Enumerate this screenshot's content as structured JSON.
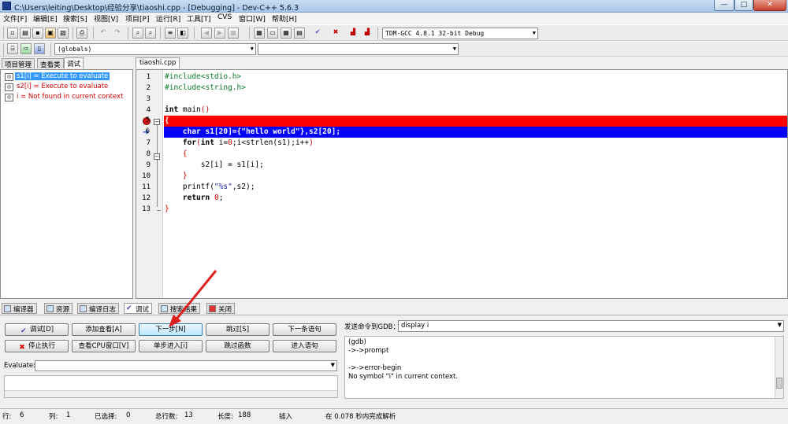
{
  "window": {
    "title": "C:\\Users\\leiting\\Desktop\\经验分享\\tiaoshi.cpp - [Debugging] - Dev-C++ 5.6.3",
    "min_label": "—",
    "max_label": "□",
    "close_label": "✕"
  },
  "menu": [
    "文件[F]",
    "编辑[E]",
    "搜索[S]",
    "视图[V]",
    "项目[P]",
    "运行[R]",
    "工具[T]",
    "CVS",
    "窗口[W]",
    "帮助[H]"
  ],
  "toolbar": {
    "compiler": "TDM-GCC 4.8.1 32-bit Debug",
    "scope": "(globals)"
  },
  "left_tabs": [
    "项目管理",
    "查看类",
    "调试"
  ],
  "watches": [
    {
      "text": "s1[i] = Execute to evaluate",
      "selected": true
    },
    {
      "text": "s2[i] = Execute to evaluate",
      "selected": false
    },
    {
      "text": "i = Not found in current context",
      "selected": false
    }
  ],
  "editor": {
    "tab": "tiaoshi.cpp",
    "line_numbers": [
      "1",
      "2",
      "3",
      "4",
      "5",
      "6",
      "7",
      "8",
      "9",
      "10",
      "11",
      "12",
      "13"
    ],
    "breakpoint_line": 5,
    "current_line": 6,
    "colors": {
      "breakpoint": "#ff0000",
      "current": "#0000ff"
    }
  },
  "code": {
    "l1": "#include<stdio.h>",
    "l2": "#include<string.h>",
    "l4a": "int",
    "l4b": " main",
    "l4c": "()",
    "l5": "{",
    "l6": "    char s1[20]={\"hello world\"},s2[20];",
    "l7a": "    ",
    "l7b": "for",
    "l7c": "(",
    "l7d": "int",
    "l7e": " i=",
    "l7f": "0",
    "l7g": ";i<strlen(s1);i++",
    "l7h": ")",
    "l8": "    {",
    "l9a": "        s2[i] = s1[i];",
    "l10": "    }",
    "l11a": "    printf(",
    "l11b": "\"%s\"",
    "l11c": ",s2);",
    "l12a": "    ",
    "l12b": "return",
    "l12c": " ",
    "l12d": "0",
    "l12e": ";",
    "l13": "}"
  },
  "bottom_tabs": [
    "编译器",
    "资源",
    "编译日志",
    "调试",
    "搜索结果",
    "关闭"
  ],
  "debug": {
    "buttons": {
      "debug": "调试[D]",
      "add_watch": "添加查看[A]",
      "next_step": "下一步[N]",
      "skip": "跳过[S]",
      "next_stmt": "下一条语句",
      "stop": "停止执行",
      "cpu_window": "查看CPU窗口[V]",
      "step_into": "单步进入[i]",
      "skip_func": "跳过函数",
      "into_stmt": "进入语句"
    },
    "evaluate_label": "Evaluate:",
    "evaluate_value": "",
    "gdb_label": "发送命令到GDB：",
    "gdb_command": "display i",
    "output": [
      "(gdb)",
      "->->prompt",
      "",
      "->->error-begin",
      "No symbol \"i\" in current context."
    ]
  },
  "status": {
    "row_label": "行:",
    "row": "6",
    "col_label": "列:",
    "col": "1",
    "sel_label": "已选择:",
    "sel": "0",
    "total_label": "总行数:",
    "total": "13",
    "len_label": "长度:",
    "len": "188",
    "mode": "插入",
    "parse": "在 0.078 秒内完成解析"
  }
}
